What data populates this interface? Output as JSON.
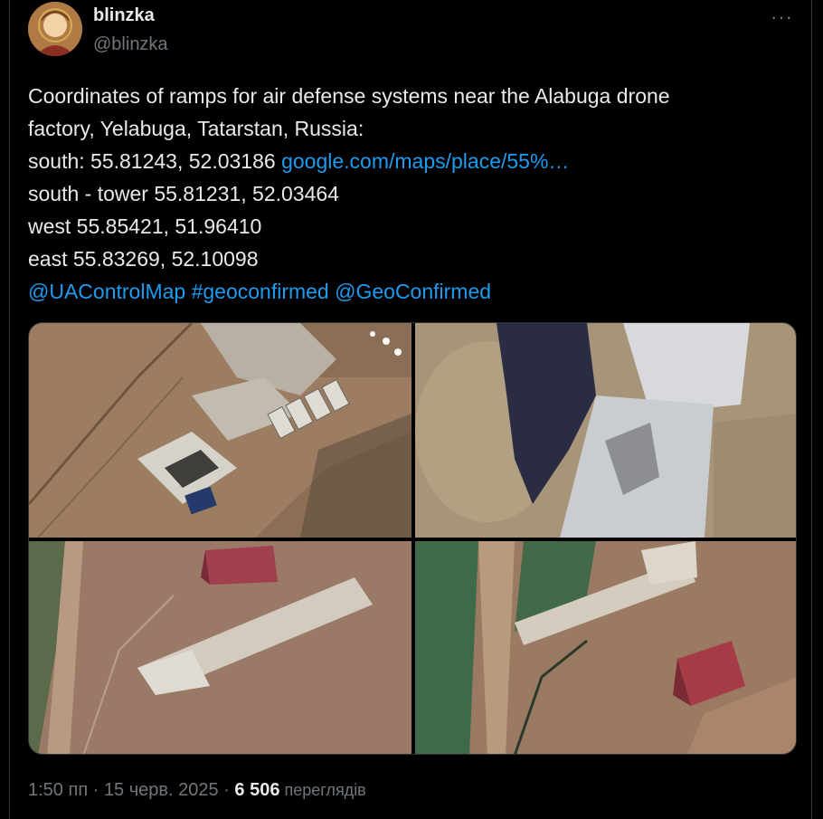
{
  "author": {
    "name": "blinzka",
    "handle": "@blinzka"
  },
  "more_label": "···",
  "tweet": {
    "lines": [
      "Coordinates of ramps for air defense systems near the Alabuga drone",
      "factory, Yelabuga, Tatarstan, Russia:"
    ],
    "south_prefix": "south: 55.81243, 52.03186 ",
    "south_link": "google.com/maps/place/55%…",
    "tower": "south - tower 55.81231, 52.03464",
    "west": "west 55.85421, 51.96410",
    "east": "east 55.83269, 52.10098",
    "mentions": [
      "@UAControlMap",
      "#geoconfirmed",
      "@GeoConfirmed"
    ]
  },
  "meta": {
    "time": "1:50 пп",
    "sep1": " · ",
    "date": "15 черв. 2025",
    "sep2": " · ",
    "views_count": "6 506",
    "views_label": " переглядів"
  },
  "colors": {
    "background": "#000000",
    "text": "#e7e9ea",
    "muted": "#71767b",
    "link": "#1d9bf0"
  }
}
